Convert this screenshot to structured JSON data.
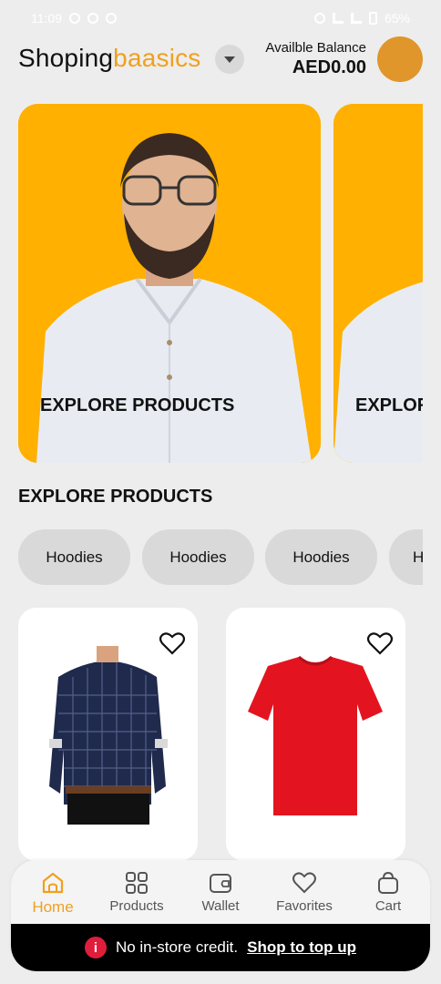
{
  "status_bar": {
    "time": "11:09",
    "battery": "65%"
  },
  "header": {
    "brand_part1": "Shoping",
    "brand_part2": "baasics",
    "balance_label": "Availble Balance",
    "balance_value": "AED0.00"
  },
  "banners": [
    {
      "caption": "EXPLORE PRODUCTS"
    },
    {
      "caption": "EXPLORE PRODUCTS"
    }
  ],
  "section": {
    "title": "EXPLORE PRODUCTS"
  },
  "chips": [
    "Hoodies",
    "Hoodies",
    "Hoodies",
    "Hoodies"
  ],
  "products": [
    {
      "image": "navy-checked-shirt",
      "favorite_icon": "heart-outline-icon"
    },
    {
      "image": "red-tshirt",
      "favorite_icon": "heart-outline-icon"
    }
  ],
  "bottom_nav": {
    "items": [
      {
        "label": "Home",
        "icon": "home-icon",
        "active": true
      },
      {
        "label": "Products",
        "icon": "grid-icon",
        "active": false
      },
      {
        "label": "Wallet",
        "icon": "wallet-icon",
        "active": false
      },
      {
        "label": "Favorites",
        "icon": "heart-icon",
        "active": false
      },
      {
        "label": "Cart",
        "icon": "bag-icon",
        "active": false
      }
    ]
  },
  "credit_bar": {
    "message": "No in-store credit.",
    "link": "Shop to top up"
  },
  "colors": {
    "accent": "#f0a020",
    "banner_bg": "#ffb000",
    "page_bg": "#ededed",
    "alert_red": "#e01e3c"
  }
}
